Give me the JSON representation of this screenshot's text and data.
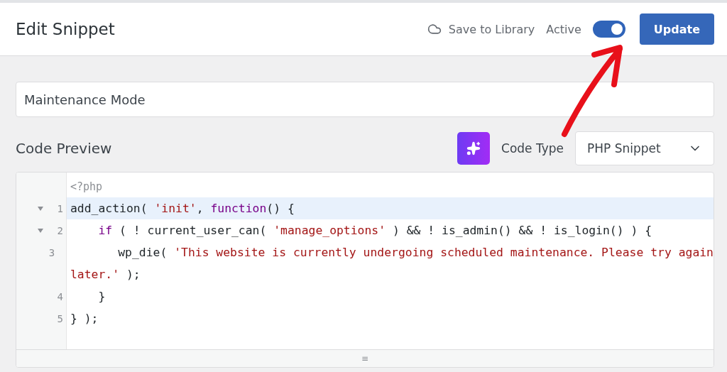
{
  "header": {
    "title": "Edit Snippet",
    "save_to_library": "Save to Library",
    "active_label": "Active",
    "active": {
      "on": true
    },
    "update_button": "Update"
  },
  "snippet_name": {
    "value": "Maintenance Mode"
  },
  "code_preview": {
    "title": "Code Preview",
    "code_type_label": "Code Type",
    "code_type": {
      "value": "PHP Snippet"
    }
  },
  "editor": {
    "rows": [
      {
        "number": null,
        "fold": false,
        "highlighted": false,
        "tokens": [
          {
            "kind": "comment",
            "text": "<?php"
          }
        ]
      },
      {
        "number": "1",
        "fold": true,
        "highlighted": true,
        "tokens": [
          {
            "kind": "plain",
            "text": "add_action( "
          },
          {
            "kind": "string",
            "text": "'init'"
          },
          {
            "kind": "plain",
            "text": ", "
          },
          {
            "kind": "keyword",
            "text": "function"
          },
          {
            "kind": "plain",
            "text": "() {"
          }
        ]
      },
      {
        "number": "2",
        "fold": true,
        "highlighted": false,
        "tokens": [
          {
            "kind": "keyword",
            "text": "    if"
          },
          {
            "kind": "plain",
            "text": " ( ! current_user_can( "
          },
          {
            "kind": "string",
            "text": "'manage_options'"
          },
          {
            "kind": "plain",
            "text": " ) && ! is_admin() && ! is_login() ) {"
          }
        ]
      },
      {
        "number": "3",
        "fold": false,
        "highlighted": false,
        "tokens": [
          {
            "kind": "plain",
            "text": "        wp_die( "
          },
          {
            "kind": "string",
            "text": "'This website is currently undergoing scheduled maintenance. Please try again"
          }
        ]
      },
      {
        "number": null,
        "fold": false,
        "highlighted": false,
        "tokens": [
          {
            "kind": "string",
            "text": "later.'"
          },
          {
            "kind": "plain",
            "text": " );"
          }
        ]
      },
      {
        "number": "4",
        "fold": false,
        "highlighted": false,
        "tokens": [
          {
            "kind": "plain",
            "text": "    }"
          }
        ]
      },
      {
        "number": "5",
        "fold": false,
        "highlighted": false,
        "tokens": [
          {
            "kind": "plain",
            "text": "} );"
          }
        ]
      }
    ],
    "resize_handle": "≡"
  }
}
